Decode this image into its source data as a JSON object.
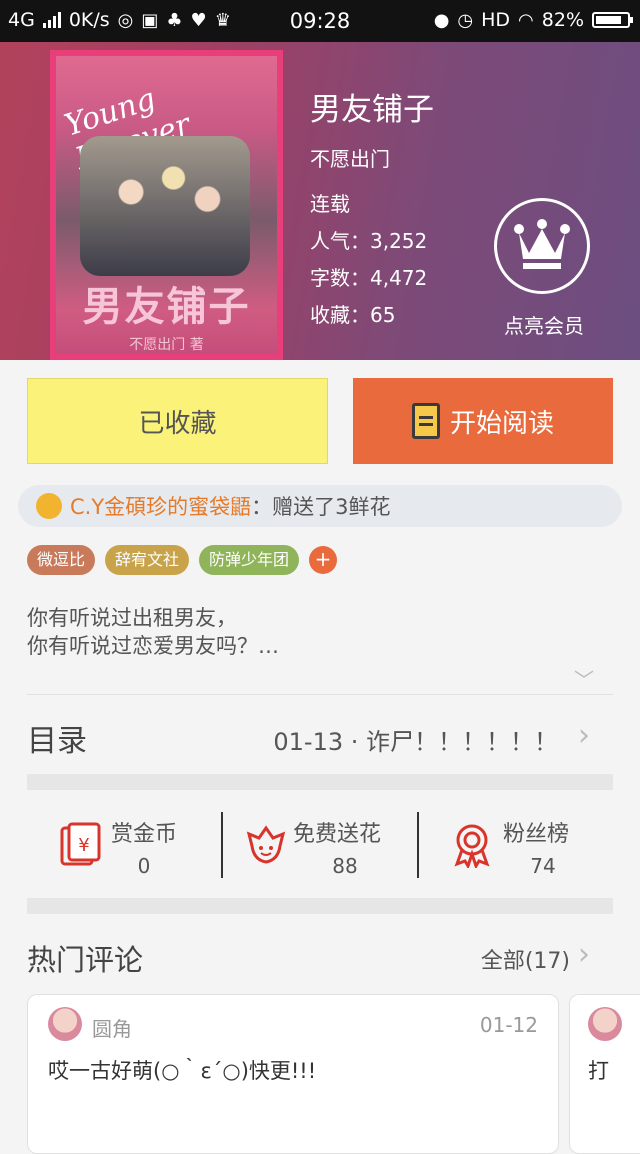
{
  "status_bar": {
    "network": "4G",
    "speed": "0K/s",
    "time": "09:28",
    "hd": "HD",
    "battery": "82%"
  },
  "book": {
    "title": "男友铺子",
    "author": "不愿出门",
    "status": "连载",
    "popularity": "人气：3,252",
    "words": "字数：4,472",
    "collections": "收藏：65",
    "cover_title": "男友铺子",
    "cover_author": "不愿出门 著",
    "cover_script": "Young Forever"
  },
  "vip": {
    "label": "点亮会员"
  },
  "actions": {
    "favorited": "已收藏",
    "start_reading": "开始阅读"
  },
  "gift_banner": {
    "user": "C.Y金碩珍的蜜袋鼯",
    "message": "：赠送了3鲜花"
  },
  "tags": [
    {
      "label": "微逗比",
      "color": "#c97a5b"
    },
    {
      "label": "辞宥文社",
      "color": "#c9a34a"
    },
    {
      "label": "防弹少年团",
      "color": "#8fb45a"
    }
  ],
  "tag_add": "+",
  "intro": {
    "line1": "你有听说过出租男友，",
    "line2": "你有听说过恋爱男友吗？…"
  },
  "toc": {
    "label": "目录",
    "latest": "01-13 · 诈尸！！！！！！"
  },
  "stats": {
    "reward": {
      "label": "赏金币",
      "value": "0"
    },
    "flowers": {
      "label": "免费送花",
      "value": "88"
    },
    "fans": {
      "label": "粉丝榜",
      "value": "74"
    }
  },
  "comments": {
    "label": "热门评论",
    "all": "全部(17)",
    "items": [
      {
        "user": "圆角",
        "date": "01-12",
        "text": "哎一古好萌(○｀ε´○)快更!!!"
      },
      {
        "user": "",
        "date": "",
        "text": "打"
      }
    ]
  },
  "colors": {
    "accent": "#e96a3c",
    "favorite_bg": "#fbf27a",
    "icon_red": "#d9342b"
  }
}
